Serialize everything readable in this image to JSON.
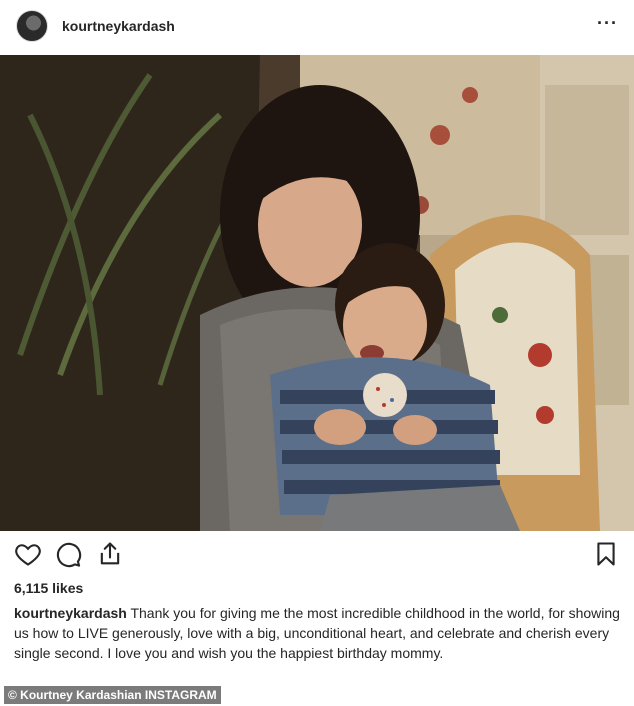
{
  "post": {
    "username": "kourtneykardash",
    "more_label": "···",
    "likes": "6,115 likes",
    "caption_user": "kourtneykardash",
    "caption_text": "Thank you for giving me the most incredible childhood in the world, for showing us how to LIVE generously, love with a big, unconditional heart, and celebrate and cherish every single second. I love you and wish you the happiest birthday mommy."
  },
  "credit": "© Kourtney Kardashian INSTAGRAM",
  "icons": {
    "like": "heart-icon",
    "comment": "comment-icon",
    "share": "share-icon",
    "save": "bookmark-icon"
  }
}
